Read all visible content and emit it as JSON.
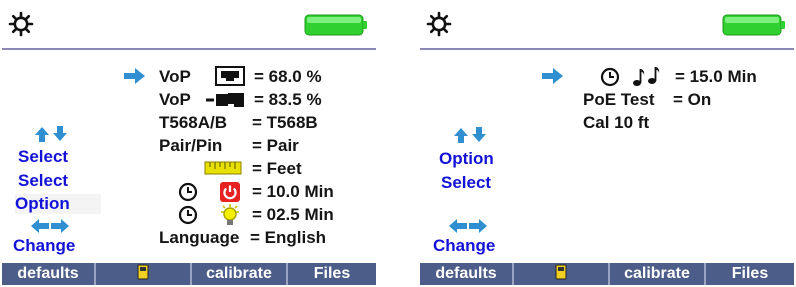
{
  "screens": [
    {
      "labels": {
        "select_1": "Select",
        "select_2": "Select",
        "option": "Option",
        "change": "Change"
      },
      "rows": {
        "vop_1_label": "VoP",
        "vop_1_value": "= 68.0 %",
        "vop_2_label": "VoP",
        "vop_2_value": "= 83.5 %",
        "wiring_label": "T568A/B",
        "wiring_value": "= T568B",
        "pairpin_label": "Pair/Pin",
        "pairpin_value": "= Pair",
        "units_value": "= Feet",
        "power_timeout_value": "= 10.0 Min",
        "backlight_timeout_value": "= 02.5 Min",
        "language_label": "Language",
        "language_value": "= English"
      },
      "footer": [
        "defaults",
        "",
        "calibrate",
        "Files"
      ],
      "icons": {
        "settings": "gear-icon",
        "battery": "battery-icon",
        "pointer": "right-arrow-icon",
        "power": "power-icon",
        "backlight": "backlight-bulb-icon",
        "clock": "clock-icon"
      }
    },
    {
      "labels": {
        "option": "Option",
        "select": "Select",
        "change": "Change"
      },
      "rows": {
        "tone_timeout_value": "= 15.0 Min",
        "poe_label": "PoE Test",
        "poe_value": "= On",
        "cal_label": "Cal 10 ft"
      },
      "footer": [
        "defaults",
        "",
        "calibrate",
        "Files"
      ],
      "icons": {
        "settings": "gear-icon",
        "battery": "battery-icon",
        "pointer": "right-arrow-icon",
        "tone": "music-notes-icon",
        "clock": "clock-icon"
      }
    }
  ],
  "colors": {
    "label_blue": "#1212d8",
    "footer_bg": "#4d5d89",
    "battery_green": "#2fd02f",
    "arrow_blue": "#2f8fd0",
    "power_red": "#e62222",
    "unit_yellow": "#e8e000"
  }
}
